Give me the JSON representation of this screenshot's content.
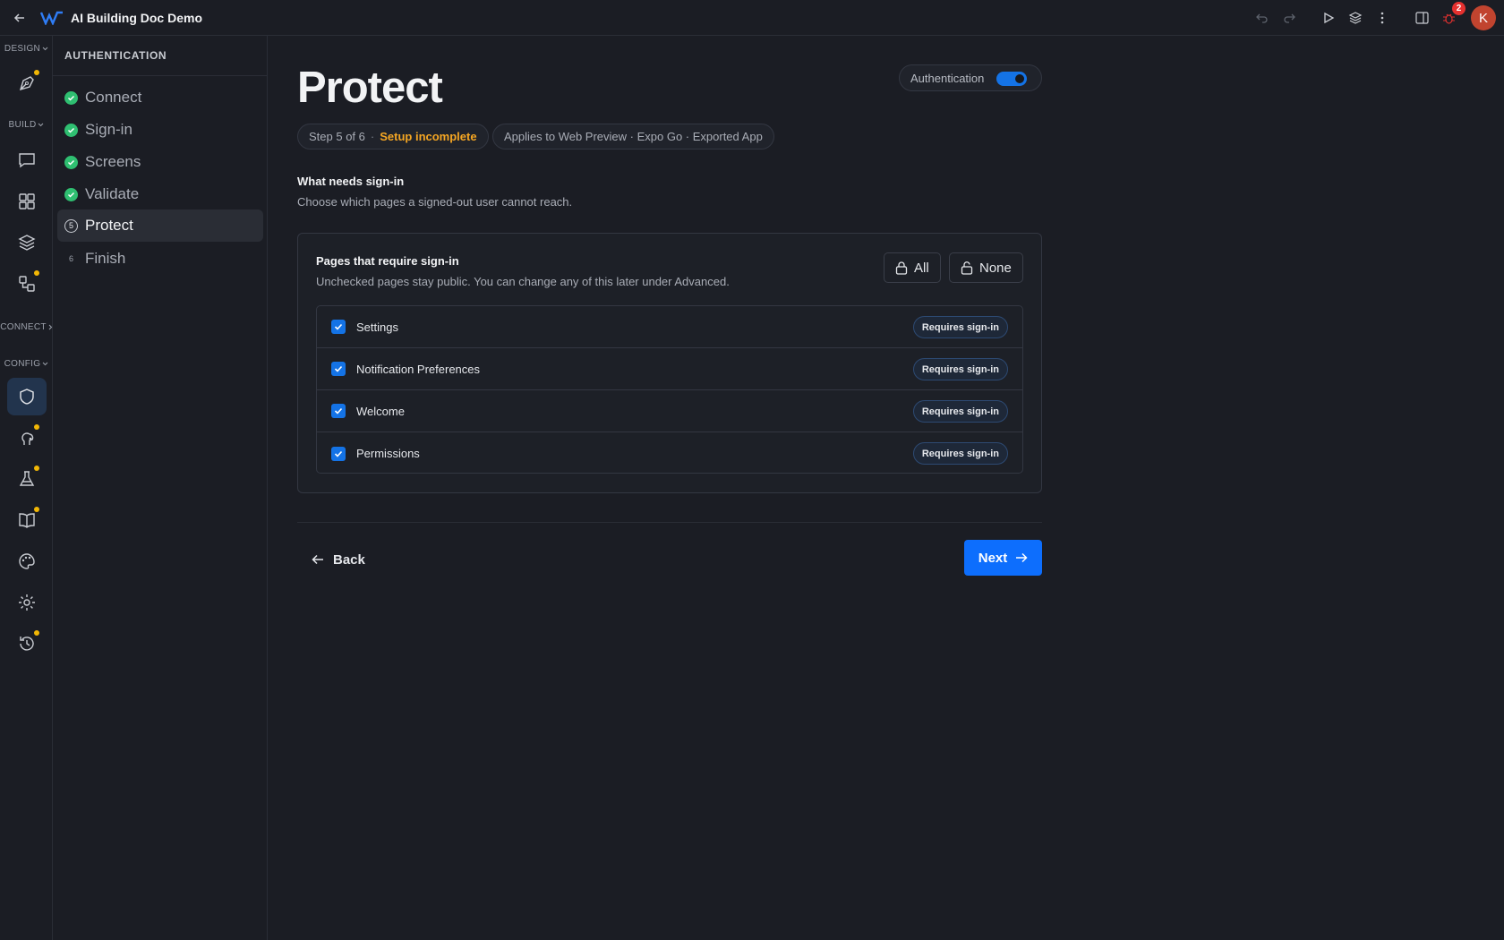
{
  "app": {
    "title": "AI Building Doc Demo",
    "avatar_initial": "K",
    "bug_count": "2",
    "accent": "#1473e6",
    "warning": "#f5a623",
    "success": "#2fbf71"
  },
  "rail": {
    "sections": {
      "design": "DESIGN",
      "build": "BUILD",
      "connect": "CONNECT",
      "config": "CONFIG"
    },
    "icons": [
      "pen-tool-icon",
      "chat-icon",
      "grid-icon",
      "layers-icon",
      "flow-icon",
      "shield-icon",
      "brain-icon",
      "flask-icon",
      "book-icon",
      "palette-icon",
      "gear-icon",
      "history-icon"
    ]
  },
  "steps": {
    "heading": "AUTHENTICATION",
    "items": [
      {
        "label": "Connect",
        "status": "done"
      },
      {
        "label": "Sign-in",
        "status": "done"
      },
      {
        "label": "Screens",
        "status": "done"
      },
      {
        "label": "Validate",
        "status": "done"
      },
      {
        "label": "Protect",
        "status": "current",
        "number": "5"
      },
      {
        "label": "Finish",
        "status": "pending",
        "number": "6"
      }
    ]
  },
  "main": {
    "title": "Protect",
    "auth_toggle_label": "Authentication",
    "auth_enabled": true,
    "step_text": "Step 5 of 6",
    "step_status": "Setup incomplete",
    "applies_text": "Applies to Web Preview · Expo Go · Exported App",
    "section_title": "What needs sign-in",
    "section_subtitle": "Choose which pages a signed-out user cannot reach.",
    "card_title": "Pages that require sign-in",
    "card_subtitle": "Unchecked pages stay public. You can change any of this later under Advanced.",
    "all_label": "All",
    "none_label": "None",
    "pages": [
      {
        "name": "Settings",
        "checked": true,
        "tag": "Requires sign-in"
      },
      {
        "name": "Notification Preferences",
        "checked": true,
        "tag": "Requires sign-in"
      },
      {
        "name": "Welcome",
        "checked": true,
        "tag": "Requires sign-in"
      },
      {
        "name": "Permissions",
        "checked": true,
        "tag": "Requires sign-in"
      }
    ],
    "back_label": "Back",
    "next_label": "Next"
  }
}
